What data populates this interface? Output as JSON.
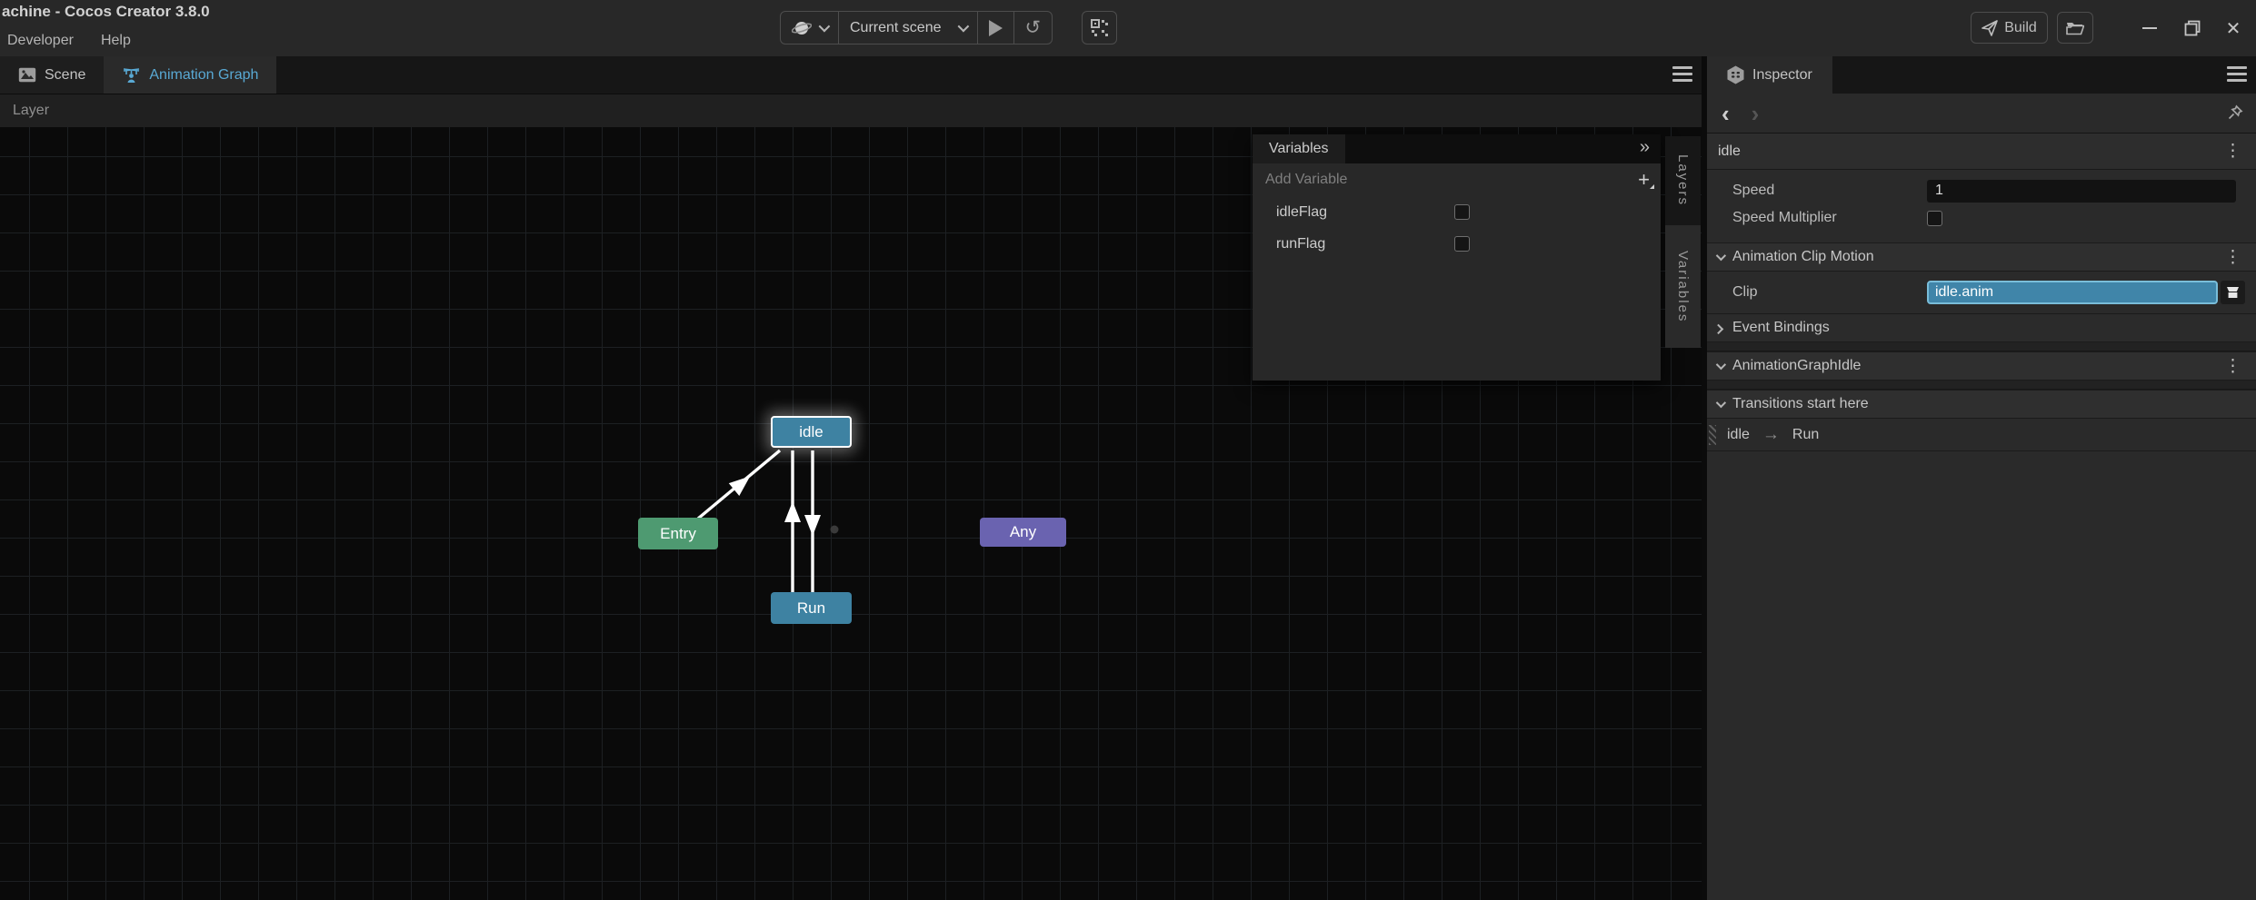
{
  "window": {
    "title": "achine - Cocos Creator 3.8.0",
    "menu": [
      "Developer",
      "Help"
    ]
  },
  "toolbar": {
    "scene_selector": "Current scene",
    "build_label": "Build"
  },
  "left_panel": {
    "tabs": [
      {
        "label": "Scene",
        "active": false
      },
      {
        "label": "Animation Graph",
        "active": true
      }
    ],
    "layer_label": "Layer"
  },
  "graph": {
    "nodes": [
      {
        "label": "idle",
        "type": "state",
        "selected": true
      },
      {
        "label": "Entry",
        "type": "entry",
        "selected": false
      },
      {
        "label": "Any",
        "type": "any",
        "selected": false
      },
      {
        "label": "Run",
        "type": "state",
        "selected": false
      }
    ],
    "edges": [
      {
        "from": "Entry",
        "to": "idle"
      },
      {
        "from": "Run",
        "to": "idle"
      },
      {
        "from": "idle",
        "to": "Run"
      }
    ]
  },
  "variables_panel": {
    "title": "Variables",
    "add_placeholder": "Add Variable",
    "variables": [
      {
        "name": "idleFlag",
        "checked": false
      },
      {
        "name": "runFlag",
        "checked": false
      }
    ]
  },
  "side_tabs": {
    "layers": "Layers",
    "variables": "Variables"
  },
  "inspector": {
    "tab_label": "Inspector",
    "selection_title": "idle",
    "speed_label": "Speed",
    "speed_value": "1",
    "multiplier_label": "Speed Multiplier",
    "sections": {
      "clip_motion": "Animation Clip Motion",
      "event_bindings": "Event Bindings",
      "graph_component": "AnimationGraphIdle",
      "transitions": "Transitions start here"
    },
    "clip_label": "Clip",
    "clip_value": "idle.anim",
    "transition": {
      "from": "idle",
      "to": "Run"
    }
  },
  "icons": {
    "collapse_right": "»",
    "add": "+",
    "kebab": "⋮",
    "back": "‹",
    "forward": "›",
    "reload": "↺",
    "close": "✕",
    "arrow_right": "→"
  },
  "colors": {
    "accent_blue": "#59a9d4",
    "node_state_teal": "#3e82a2",
    "node_entry_green": "#4e9a71",
    "node_any_purple": "#6a63b0",
    "clip_field_blue": "#4085a9",
    "canvas_bg": "#0a0a0a",
    "panel_bg": "#2a2a2a"
  }
}
